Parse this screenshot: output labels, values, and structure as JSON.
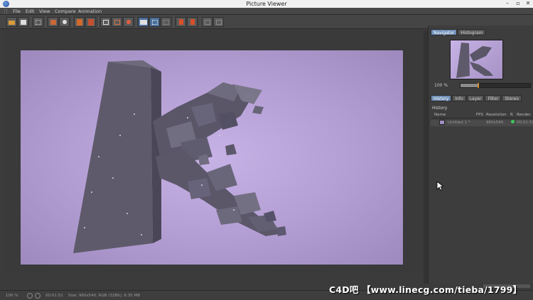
{
  "window": {
    "title": "Picture Viewer"
  },
  "menu": {
    "items": [
      "File",
      "Edit",
      "View",
      "Compare",
      "Animation"
    ]
  },
  "navigator": {
    "tabs": [
      {
        "label": "Navigator",
        "active": true
      },
      {
        "label": "Histogram",
        "active": false
      }
    ],
    "zoom_label": "100 %"
  },
  "info_tabs": [
    {
      "label": "History",
      "active": true
    },
    {
      "label": "Info",
      "active": false
    },
    {
      "label": "Layer",
      "active": false
    },
    {
      "label": "Filter",
      "active": false
    },
    {
      "label": "Stereo",
      "active": false
    }
  ],
  "history": {
    "section_title": "History",
    "columns": {
      "name": "Name",
      "fps": "FPS",
      "resolution": "Resolution",
      "r": "R",
      "render": "Render"
    },
    "rows": [
      {
        "name": "Untitled 1 *",
        "resolution": "960x540",
        "render": "00:01:51",
        "status_color": "#3fc65a"
      }
    ]
  },
  "status": {
    "zoom": "100 %",
    "time": "00:01:51",
    "info": "Size: 960x540, RGB (32Bit), 6.35 MB"
  },
  "watermark": "C4D吧 【www.linecg.com/tieba/1799】",
  "colors": {
    "accent": "#6f8fb7",
    "render_bg": "#c7b2e6",
    "object": "#5e5a6b"
  }
}
